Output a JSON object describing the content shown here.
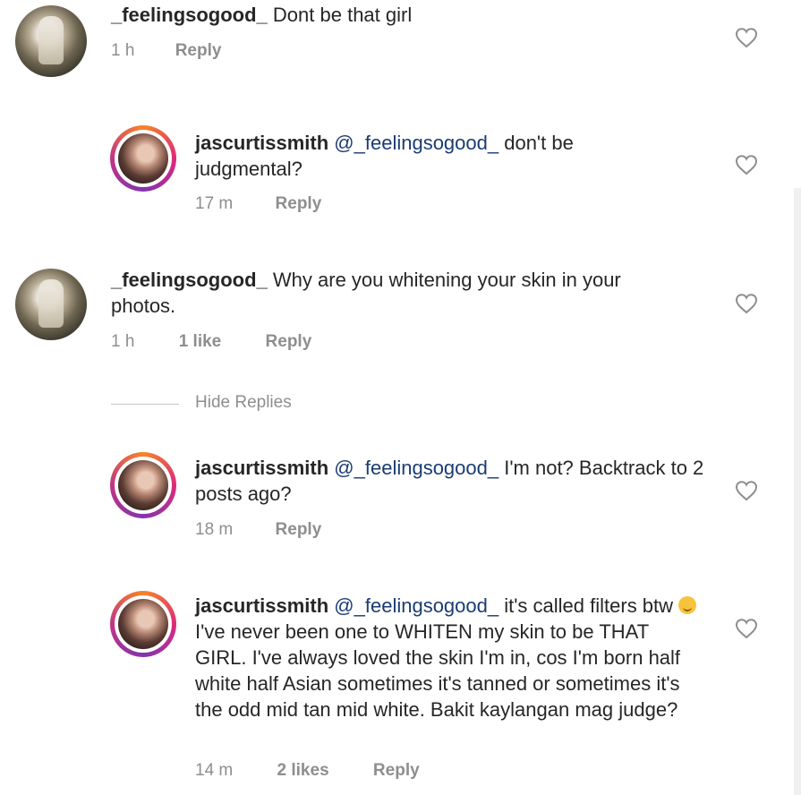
{
  "comments": [
    {
      "username": "_feelingsogood_",
      "mention": "",
      "text": " Dont be that girl",
      "time": "1 h",
      "likes": "",
      "reply_label": "Reply",
      "avatar": "statue-avatar"
    },
    {
      "username": "jascurtissmith",
      "mention": "@_feelingsogood_",
      "text": " don't be judgmental?",
      "time": "17 m",
      "likes": "",
      "reply_label": "Reply",
      "avatar": "selfie-avatar"
    },
    {
      "username": "_feelingsogood_",
      "mention": "",
      "text": " Why are you whitening your skin in your photos.",
      "time": "1 h",
      "likes": "1 like",
      "reply_label": "Reply",
      "avatar": "statue-avatar"
    },
    {
      "username": "jascurtissmith",
      "mention": "@_feelingsogood_",
      "text": " I'm not? Backtrack to 2 posts ago?",
      "time": "18 m",
      "likes": "",
      "reply_label": "Reply",
      "avatar": "selfie-avatar"
    },
    {
      "username": "jascurtissmith",
      "mention": "@_feelingsogood_",
      "text_before_emoji": " it's called filters btw",
      "text_after_emoji": " I've never been one to WHITEN my skin to be THAT GIRL. I've always loved the skin I'm in, cos I'm born half white half Asian sometimes it's tanned or sometimes it's the odd mid tan mid white. Bakit kaylangan mag judge?",
      "time": "14 m",
      "likes": "2 likes",
      "reply_label": "Reply",
      "avatar": "selfie-avatar"
    }
  ],
  "hide_replies_label": "Hide Replies",
  "icons": {
    "like": "heart-outline-icon",
    "emoji": "smiling-face-emoji"
  },
  "colors": {
    "text": "#262626",
    "mention": "#1b3c73",
    "meta": "#8e8e8e",
    "story_ring": "#dd2a7b"
  }
}
